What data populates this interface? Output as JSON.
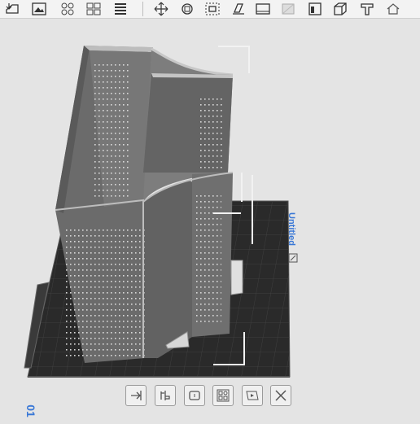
{
  "toolbar": {
    "buttons": [
      {
        "name": "import-icon"
      },
      {
        "name": "gallery-icon"
      },
      {
        "name": "arrange-grid-icon"
      },
      {
        "name": "layout-icon"
      },
      {
        "name": "list-menu-icon"
      },
      {
        "name": "move-icon"
      },
      {
        "name": "rotate-icon"
      },
      {
        "name": "scale-icon"
      },
      {
        "name": "place-on-face-icon"
      },
      {
        "name": "cut-icon"
      },
      {
        "name": "support-paint-icon"
      },
      {
        "name": "seam-paint-icon"
      },
      {
        "name": "box-view-icon"
      },
      {
        "name": "text-tool-icon"
      },
      {
        "name": "measure-icon"
      }
    ]
  },
  "plate": {
    "name": "Untitled",
    "number": "01",
    "edit_icon": "edit-icon"
  },
  "bottom_toolbar": {
    "buttons": [
      {
        "name": "orient-icon"
      },
      {
        "name": "arrange-icon"
      },
      {
        "name": "lock-icon"
      },
      {
        "name": "plate-settings-icon"
      },
      {
        "name": "auto-orient-icon"
      },
      {
        "name": "delete-icon"
      }
    ]
  },
  "colors": {
    "background": "#e4e4e4",
    "plate": "#2b2b2b",
    "model": "#6d6d6d",
    "accent": "#3a78d6"
  }
}
